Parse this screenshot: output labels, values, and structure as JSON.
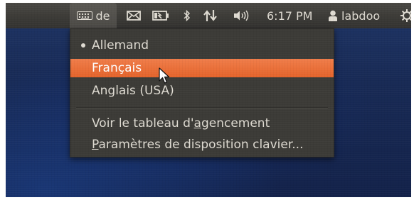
{
  "panel": {
    "keyboard_layout_code": "de",
    "time": "6:17 PM",
    "user": "labdoo",
    "icons": [
      "keyboard-icon",
      "mail-icon",
      "battery-icon",
      "bluetooth-icon",
      "network-icon",
      "volume-icon",
      "user-icon",
      "power-icon"
    ]
  },
  "keyboard_menu": {
    "items": [
      {
        "label": "Allemand",
        "selected": true
      },
      {
        "label": "Français",
        "highlighted": true
      },
      {
        "label": "Anglais (USA)"
      }
    ],
    "show_layout_pre": "Voir le tableau d'",
    "show_layout_mnemonic": "a",
    "show_layout_post": "gencement",
    "settings_mnemonic": "P",
    "settings_post": "aramètres de disposition clavier..."
  },
  "colors": {
    "panel_bg": "#3c3b37",
    "highlight": "#e5642b",
    "text": "#dfdbd2"
  }
}
